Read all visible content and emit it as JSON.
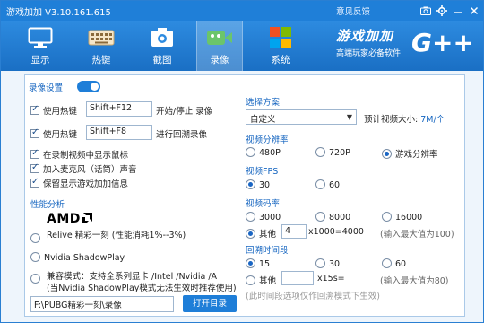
{
  "window": {
    "title": "游戏加加 V3.10.161.615",
    "feedback": "意见反馈",
    "controls": [
      "camera-icon",
      "gear-icon",
      "minimize-icon",
      "close-icon"
    ]
  },
  "toolbar": {
    "tabs": [
      {
        "label": "显示",
        "icon": "monitor-icon"
      },
      {
        "label": "热键",
        "icon": "keyboard-icon"
      },
      {
        "label": "截图",
        "icon": "screenshot-icon"
      },
      {
        "label": "录像",
        "icon": "record-icon",
        "active": true
      },
      {
        "label": "系统",
        "icon": "windows-icon"
      }
    ],
    "brand_name": "游戏加加",
    "brand_slogan": "高端玩家必备软件",
    "brand_logo_text": "G++"
  },
  "left": {
    "record_settings_label": "录像设置",
    "record_toggle_on": true,
    "hotkey1": {
      "checked": true,
      "label": "使用热键",
      "value": "Shift+F12",
      "action": "开始/停止 录像"
    },
    "hotkey2": {
      "checked": true,
      "label": "使用热键",
      "value": "Shift+F8",
      "action": "进行回溯录像"
    },
    "show_cursor": {
      "checked": true,
      "label": "在录制视频中显示鼠标"
    },
    "add_mic": {
      "checked": true,
      "label": "加入麦克风（话筒）声音"
    },
    "keep_info": {
      "checked": true,
      "label": "保留显示游戏加加信息"
    },
    "perf_title": "性能分析",
    "perf_amd_logo": "AMD",
    "perf_amd_text": "Relive 精彩一刻 (性能消耗1%--3%)",
    "perf_nvidia": "Nvidia ShadowPlay",
    "perf_compat_line1": "兼容模式：支持全系列显卡 /Intel /Nvidia /A",
    "perf_compat_line2": "(当Nvidia ShadowPlay模式无法生效时推荐使用)",
    "path_value": "F:\\PUBG精彩一刻\\录像",
    "open_dir_button": "打开目录"
  },
  "right": {
    "scheme_title": "选择方案",
    "scheme_value": "自定义",
    "estimate_label": "预计视频大小:",
    "estimate_value": "7M/个",
    "resolution_title": "视频分辨率",
    "resolution_options": [
      "480P",
      "720P",
      "游戏分辨率"
    ],
    "resolution_selected": 2,
    "fps_title": "视频FPS",
    "fps_options": [
      "30",
      "60"
    ],
    "fps_selected": 0,
    "bitrate_title": "视频码率",
    "bitrate_options": [
      "3000",
      "8000",
      "16000"
    ],
    "bitrate_other_label": "其他",
    "bitrate_other_value": "4",
    "bitrate_other_suffix": "x1000=4000",
    "bitrate_hint": "(输入最大值为100)",
    "bitrate_selected": "other",
    "backtrack_title": "回溯时间段",
    "backtrack_options": [
      "15",
      "30",
      "60"
    ],
    "backtrack_selected": 0,
    "backtrack_other_label": "其他",
    "backtrack_other_value": "",
    "backtrack_other_suffix": "x15s=",
    "backtrack_hint": "(输入最大值为80)",
    "backtrack_note": "(此时间段选项仅作回溯模式下生效)"
  },
  "colors": {
    "titlebar": "#1f7fd8",
    "accent": "#1e7ed8",
    "section_text": "#1565c0",
    "panel_bg": "#eef5fc"
  }
}
